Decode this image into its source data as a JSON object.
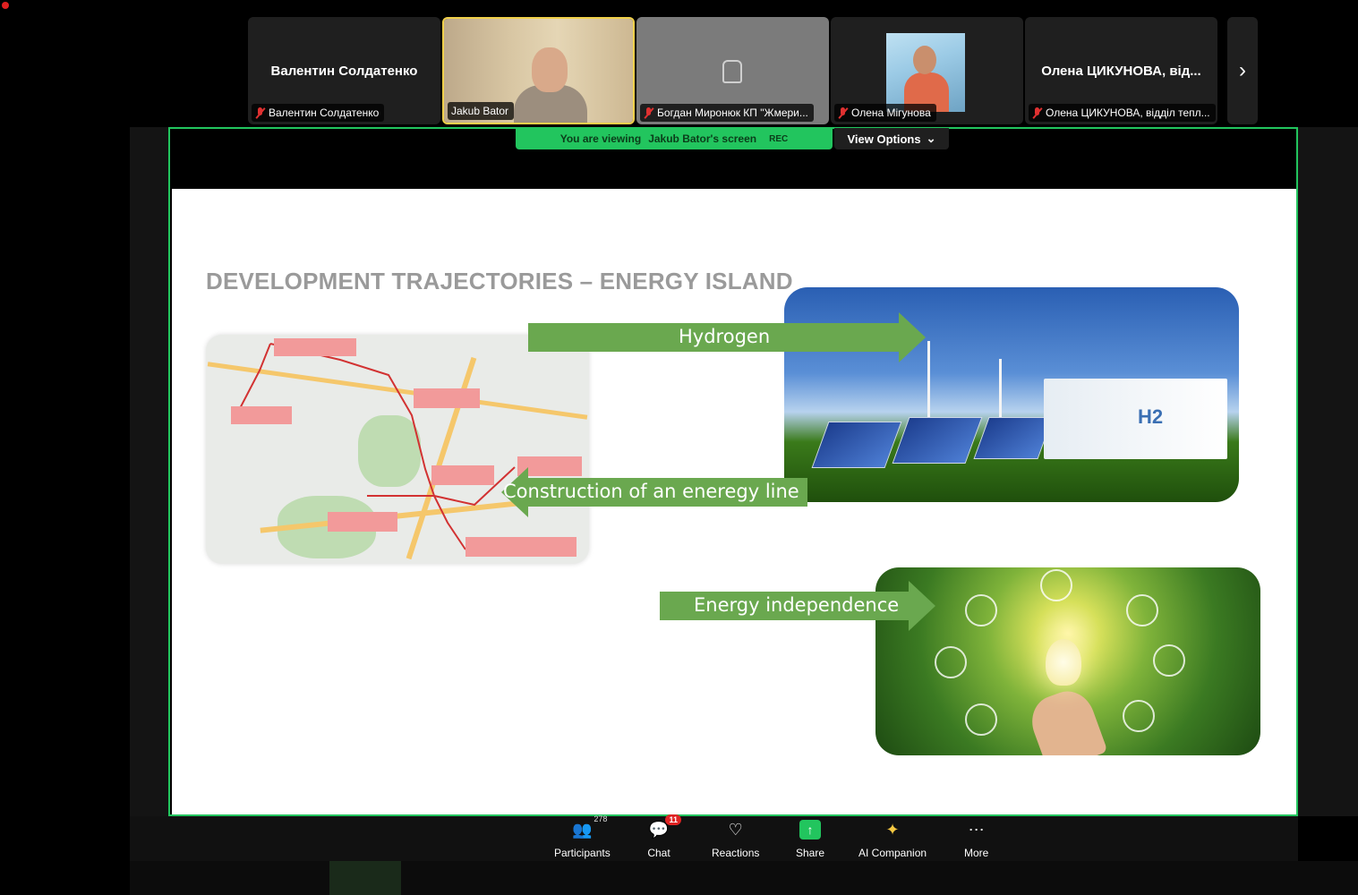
{
  "participants_strip": [
    {
      "big_name": "Валентин Солдатенко",
      "tag": "Валентин Солдатенко",
      "muted": true
    },
    {
      "big_name": "",
      "tag": "Jakub Bator",
      "muted": false
    },
    {
      "big_name": "",
      "tag": "Богдан Миронюк КП \"Жмери...",
      "muted": true
    },
    {
      "big_name": "",
      "tag": "Олена Мігунова",
      "muted": true
    },
    {
      "big_name": "Олена ЦИКУНОВА, від...",
      "tag": "Олена ЦИКУНОВА, відділ тепл...",
      "muted": true
    }
  ],
  "share_bar": {
    "viewing_prefix": "You are viewing",
    "viewing_name": "Jakub Bator's screen",
    "rec": "REC",
    "view_options": "View Options"
  },
  "slide": {
    "title": "DEVELOPMENT TRAJECTORIES – ENERGY ISLAND",
    "arrow_hydrogen": "Hydrogen",
    "arrow_line": "Construction of an eneregy line",
    "arrow_independence": "Energy independence",
    "image_badge": "H2"
  },
  "toolbar": {
    "participants": "Participants",
    "participants_count": "278",
    "chat": "Chat",
    "chat_badge": "11",
    "reactions": "Reactions",
    "share": "Share",
    "ai": "AI Companion",
    "more": "More"
  },
  "colors": {
    "share_border": "#22c55e",
    "arrow_green": "#6aa84f",
    "title_gray": "#9a9a9a"
  }
}
